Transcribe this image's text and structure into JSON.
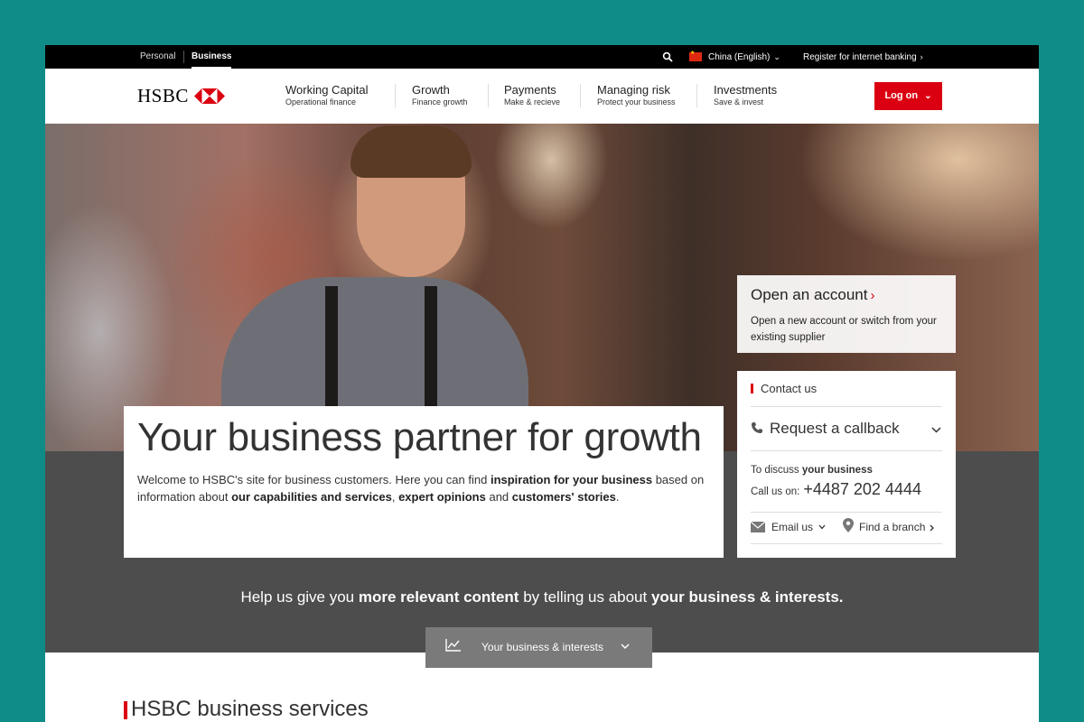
{
  "topbar": {
    "personal_label": "Personal",
    "business_label": "Business",
    "country_label": "China (English)",
    "register_label": "Register for internet banking"
  },
  "nav": {
    "logo_text": "HSBC",
    "items": [
      {
        "title": "Working Capital",
        "subtitle": "Operational finance"
      },
      {
        "title": "Growth",
        "subtitle": "Finance growth"
      },
      {
        "title": "Payments",
        "subtitle": "Make & recieve"
      },
      {
        "title": "Managing risk",
        "subtitle": "Protect your business"
      },
      {
        "title": "Investments",
        "subtitle": "Save & invest"
      }
    ],
    "logon_label": "Log on"
  },
  "hero": {
    "open_account": {
      "title": "Open an account",
      "text": "Open a new account or switch from your existing supplier"
    },
    "headline": "Your business partner for growth",
    "intro": {
      "p1": "Welcome to HSBC's site for business customers. Here you can find ",
      "b1": "inspiration for your business",
      "p2": " based on information about ",
      "b2": "our capabilities and services",
      "p3": ", ",
      "b3": "expert opinions",
      "p4": " and ",
      "b4": "customers' stories",
      "p5": "."
    }
  },
  "contact": {
    "heading": "Contact us",
    "callback_label": "Request a callback",
    "discuss_prefix": "To discuss ",
    "discuss_bold": "your business",
    "call_prefix": "Call us on:",
    "phone": "+4487 202 4444",
    "email_label": "Email us",
    "branch_label": "Find a branch"
  },
  "interests": {
    "help": {
      "p1": "Help us give you ",
      "b1": "more relevant content",
      "p2": " by telling us about ",
      "b2": "your business & interests."
    },
    "button_label": "Your business & interests"
  },
  "services": {
    "heading": "HSBC business services"
  },
  "colors": {
    "brand_red": "#db0011",
    "page_bg": "#0f8c87",
    "band_grey": "#4d4d4d"
  }
}
